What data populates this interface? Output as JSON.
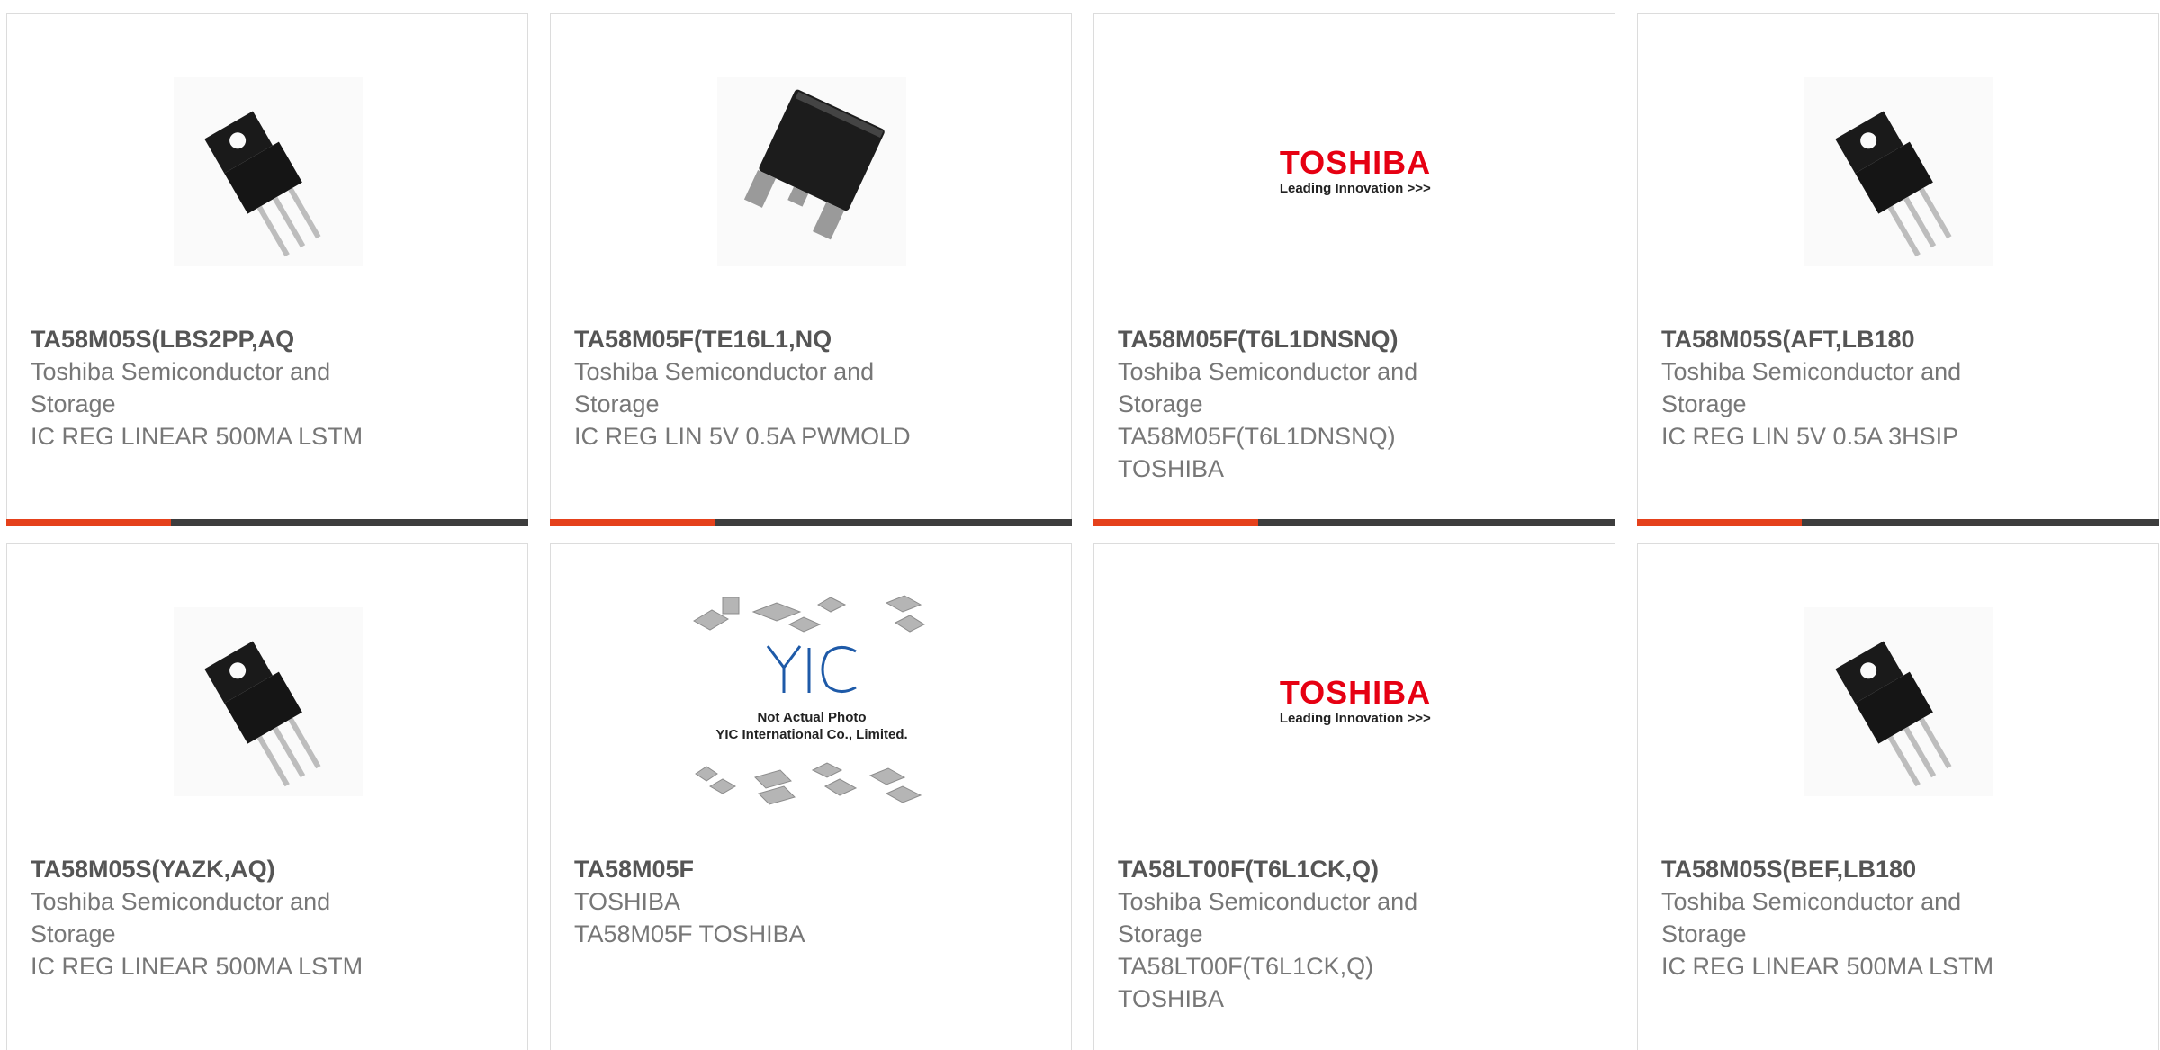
{
  "colors": {
    "accent": "#e5411b",
    "bar": "#3d3d3d",
    "title": "#555555",
    "text": "#777777",
    "toshiba_red": "#e60012"
  },
  "products": [
    {
      "part_number": "TA58M05S(LBS2PP,AQ",
      "manufacturer": [
        "Toshiba Semiconductor and",
        "Storage"
      ],
      "description": [
        "IC REG LINEAR 500MA LSTM"
      ],
      "image": "to220-transistor-image"
    },
    {
      "part_number": "TA58M05F(TE16L1,NQ",
      "manufacturer": [
        "Toshiba Semiconductor and",
        "Storage"
      ],
      "description": [
        "IC REG LIN 5V 0.5A PWMOLD"
      ],
      "image": "dpak-package-image"
    },
    {
      "part_number": "TA58M05F(T6L1DNSNQ)",
      "manufacturer": [
        "Toshiba Semiconductor and",
        "Storage"
      ],
      "description": [
        "TA58M05F(T6L1DNSNQ)",
        "TOSHIBA"
      ],
      "image": "toshiba-logo",
      "logo": {
        "word": "TOSHIBA",
        "tagline": "Leading Innovation >>>"
      }
    },
    {
      "part_number": "TA58M05S(AFT,LB180",
      "manufacturer": [
        "Toshiba Semiconductor and",
        "Storage"
      ],
      "description": [
        "IC REG LIN 5V 0.5A 3HSIP"
      ],
      "image": "to220-transistor-image"
    },
    {
      "part_number": "TA58M05S(YAZK,AQ)",
      "manufacturer": [
        "Toshiba Semiconductor and",
        "Storage"
      ],
      "description": [
        "IC REG LINEAR 500MA LSTM"
      ],
      "image": "to220-transistor-image"
    },
    {
      "part_number": "TA58M05F",
      "manufacturer": [
        "TOSHIBA"
      ],
      "description": [
        "TA58M05F TOSHIBA"
      ],
      "image": "not-actual-photo-placeholder",
      "placeholder": {
        "brand": "YIC",
        "line1": "Not Actual Photo",
        "line2": "YIC International Co., Limited."
      }
    },
    {
      "part_number": "TA58LT00F(T6L1CK,Q)",
      "manufacturer": [
        "Toshiba Semiconductor and",
        "Storage"
      ],
      "description": [
        "TA58LT00F(T6L1CK,Q)",
        "TOSHIBA"
      ],
      "image": "toshiba-logo",
      "logo": {
        "word": "TOSHIBA",
        "tagline": "Leading Innovation >>>"
      }
    },
    {
      "part_number": "TA58M05S(BEF,LB180",
      "manufacturer": [
        "Toshiba Semiconductor and",
        "Storage"
      ],
      "description": [
        "IC REG LINEAR 500MA LSTM"
      ],
      "image": "to220-transistor-image"
    }
  ]
}
